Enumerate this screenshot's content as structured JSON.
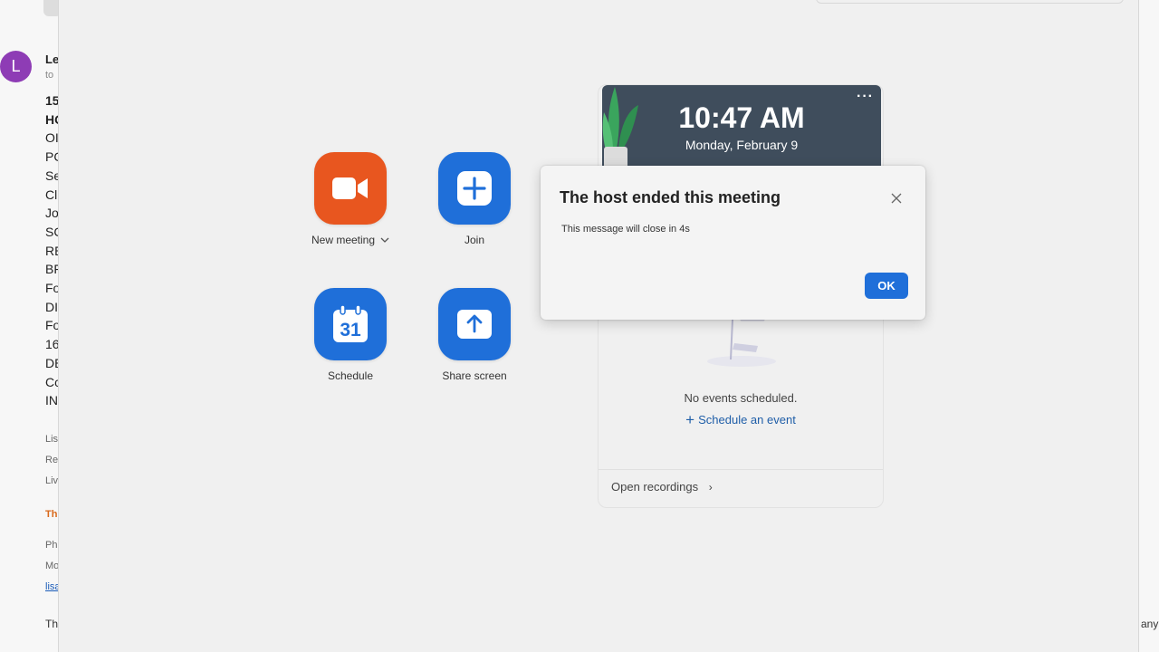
{
  "email": {
    "avatar_letter": "L",
    "sender": "Le",
    "to": "to",
    "lines": [
      "15",
      "HC",
      "OI",
      "PC",
      "Se",
      "Cl",
      "Jo",
      "SC",
      "RE",
      "BF",
      "Fo",
      "DI",
      "Fo",
      "16",
      "DE",
      "Cc",
      "IN"
    ],
    "footer": [
      "Lis",
      "Re",
      "Liv"
    ],
    "footer_orange": "Th",
    "footer2": [
      "Ph",
      "Mo"
    ],
    "footer_link": "lisa",
    "footer_last": "Th",
    "right_fragment": "any"
  },
  "actions": {
    "new_meeting": "New meeting",
    "join": "Join",
    "schedule": "Schedule",
    "calendar_day": "31",
    "share_screen": "Share screen"
  },
  "clock": {
    "time": "10:47 AM",
    "date": "Monday, February 9"
  },
  "events": {
    "empty_text": "No events scheduled.",
    "schedule_link": "Schedule an event",
    "open_recordings": "Open recordings"
  },
  "dialog": {
    "title": "The host ended this meeting",
    "message": "This message will close in 4s",
    "ok_label": "OK"
  },
  "colors": {
    "orange": "#e8561f",
    "blue": "#1f6fd9",
    "clock_bg": "#3f4d5c",
    "avatar": "#8e3cb5"
  }
}
